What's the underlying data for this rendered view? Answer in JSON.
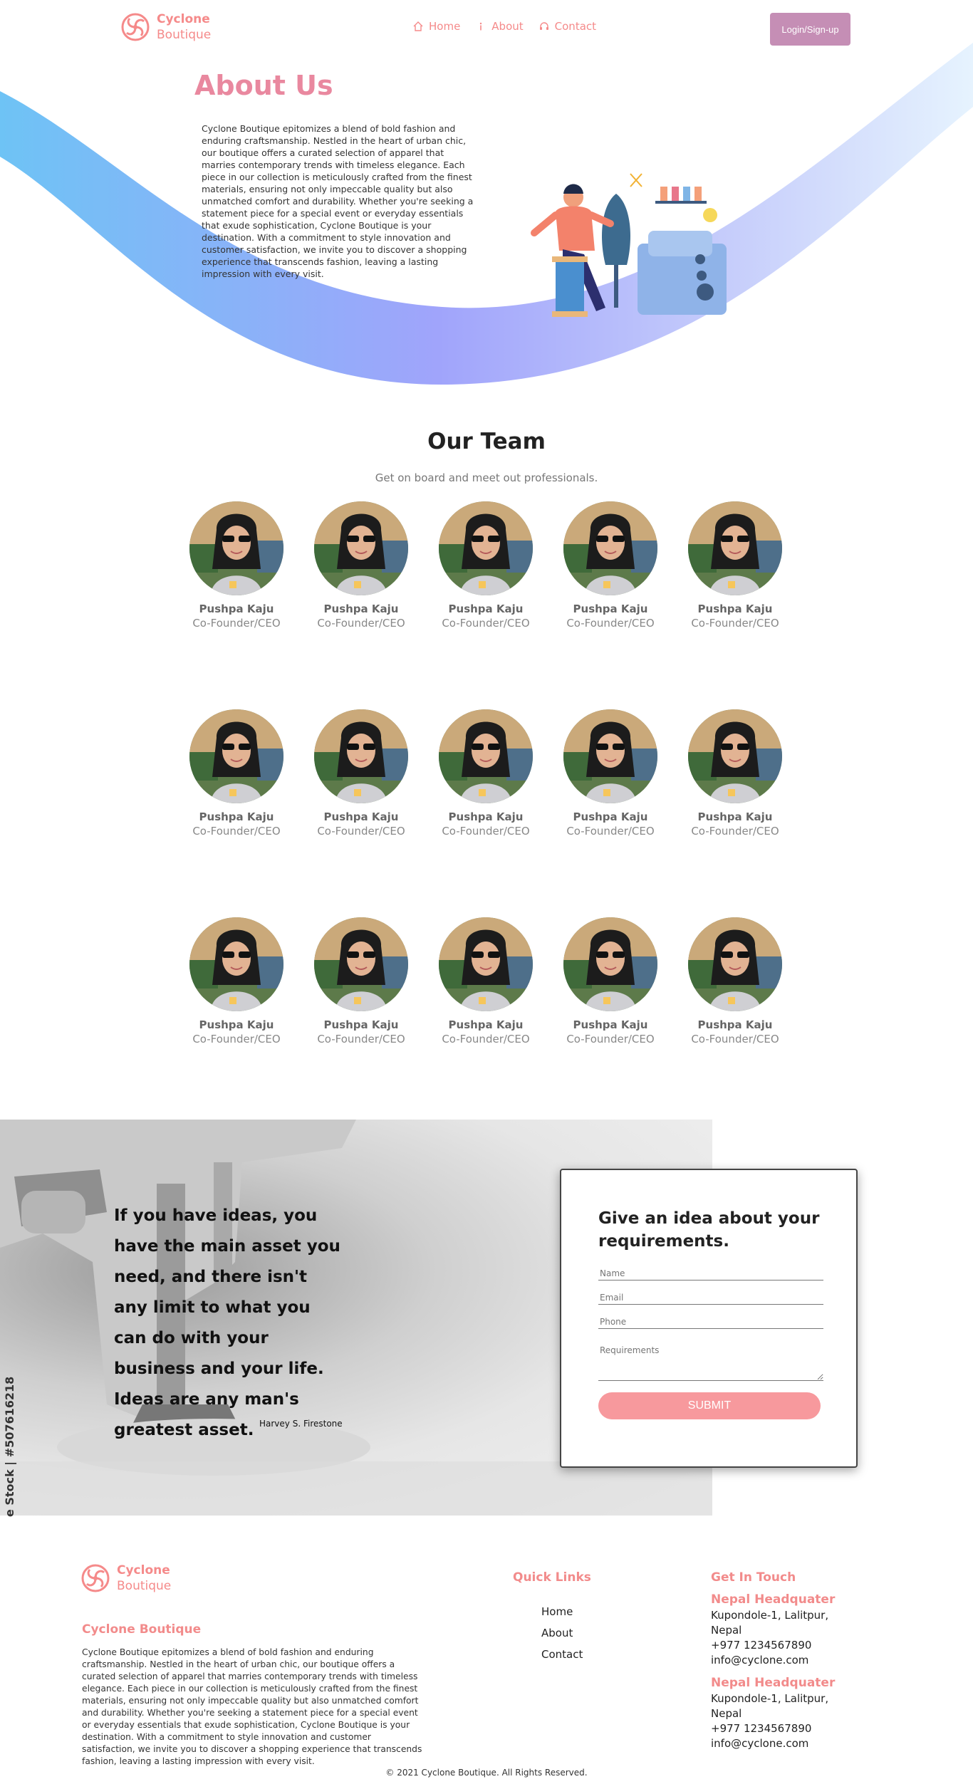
{
  "header": {
    "brand_line1": "Cyclone",
    "brand_line2": "Boutique",
    "nav": [
      {
        "label": "Home",
        "icon": "home-icon"
      },
      {
        "label": "About",
        "icon": "info-icon"
      },
      {
        "label": "Contact",
        "icon": "headset-icon"
      }
    ],
    "login_label": "Login/Sign-up"
  },
  "about": {
    "title": "About Us",
    "text": "Cyclone Boutique epitomizes a blend of bold fashion and enduring craftsmanship. Nestled in the heart of urban chic, our boutique offers a curated selection of apparel that marries contemporary trends with timeless elegance. Each piece in our collection is meticulously crafted from the finest materials, ensuring not only impeccable quality but also unmatched comfort and durability. Whether you're seeking a statement piece for a special event or everyday essentials that exude sophistication, Cyclone Boutique is your destination. With a commitment to style innovation and customer satisfaction, we invite you to discover a shopping experience that transcends fashion, leaving a lasting impression with every visit."
  },
  "team": {
    "title": "Our Team",
    "subtitle": "Get on board and meet out professionals.",
    "members": [
      {
        "name": "Pushpa Kaju",
        "role": "Co-Founder/CEO"
      },
      {
        "name": "Pushpa Kaju",
        "role": "Co-Founder/CEO"
      },
      {
        "name": "Pushpa Kaju",
        "role": "Co-Founder/CEO"
      },
      {
        "name": "Pushpa Kaju",
        "role": "Co-Founder/CEO"
      },
      {
        "name": "Pushpa Kaju",
        "role": "Co-Founder/CEO"
      },
      {
        "name": "Pushpa Kaju",
        "role": "Co-Founder/CEO"
      },
      {
        "name": "Pushpa Kaju",
        "role": "Co-Founder/CEO"
      },
      {
        "name": "Pushpa Kaju",
        "role": "Co-Founder/CEO"
      },
      {
        "name": "Pushpa Kaju",
        "role": "Co-Founder/CEO"
      },
      {
        "name": "Pushpa Kaju",
        "role": "Co-Founder/CEO"
      },
      {
        "name": "Pushpa Kaju",
        "role": "Co-Founder/CEO"
      },
      {
        "name": "Pushpa Kaju",
        "role": "Co-Founder/CEO"
      },
      {
        "name": "Pushpa Kaju",
        "role": "Co-Founder/CEO"
      },
      {
        "name": "Pushpa Kaju",
        "role": "Co-Founder/CEO"
      },
      {
        "name": "Pushpa Kaju",
        "role": "Co-Founder/CEO"
      }
    ]
  },
  "quote": {
    "text": "If you have ideas, you have the main asset you need, and there isn't any limit to what you can do with your business and your life. Ideas are any man's greatest asset.",
    "author": "Harvey S. Firestone",
    "stock_label": "e Stock | #507616218"
  },
  "form": {
    "title": "Give an idea about your requirements.",
    "name_placeholder": "Name",
    "email_placeholder": "Email",
    "phone_placeholder": "Phone",
    "requirements_placeholder": "Requirements",
    "submit_label": "SUBMIT"
  },
  "footer": {
    "brand_line1": "Cyclone",
    "brand_line2": "Boutique",
    "about_title": "Cyclone Boutique",
    "about_text": "Cyclone Boutique epitomizes a blend of bold fashion and enduring craftsmanship. Nestled in the heart of urban chic, our boutique offers a curated selection of apparel that marries contemporary trends with timeless elegance. Each piece in our collection is meticulously crafted from the finest materials, ensuring not only impeccable quality but also unmatched comfort and durability. Whether you're seeking a statement piece for a special event or everyday essentials that exude sophistication, Cyclone Boutique is your destination. With a commitment to style innovation and customer satisfaction, we invite you to discover a shopping experience that transcends fashion, leaving a lasting impression with every visit.",
    "quick_links_title": "Quick Links",
    "quick_links": [
      "Home",
      "About",
      "Contact"
    ],
    "get_in_touch_title": "Get In Touch",
    "headquarters": [
      {
        "title": "Nepal Headquater",
        "address": "Kupondole-1, Lalitpur, Nepal",
        "phone": "+977 1234567890",
        "email": "info@cyclone.com"
      },
      {
        "title": "Nepal Headquater",
        "address": "Kupondole-1, Lalitpur, Nepal",
        "phone": "+977 1234567890",
        "email": "info@cyclone.com"
      }
    ],
    "copyright": "© 2021 Cyclone Boutique. All Rights Reserved."
  },
  "colors": {
    "brand": "#f58a8a",
    "login_button": "#c58eb5",
    "submit_button": "#f7999d",
    "about_title": "#e9889f"
  }
}
